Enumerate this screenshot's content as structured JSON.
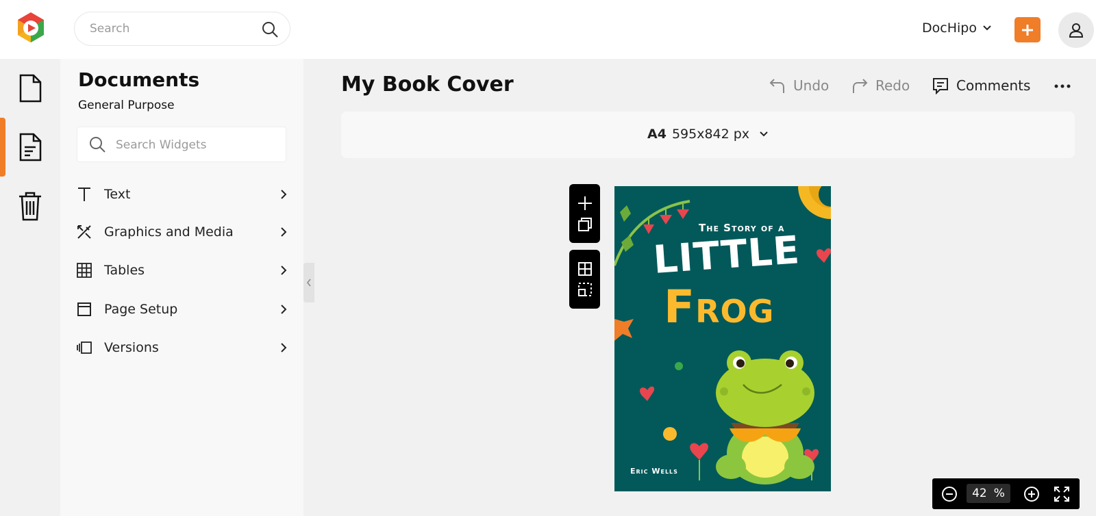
{
  "header": {
    "search_placeholder": "Search",
    "account_name": "DocHipo"
  },
  "panel": {
    "title": "Documents",
    "subtitle": "General Purpose",
    "search_placeholder": "Search Widgets",
    "items": [
      {
        "label": "Text",
        "icon": "text-icon"
      },
      {
        "label": "Graphics and Media",
        "icon": "graphics-icon"
      },
      {
        "label": "Tables",
        "icon": "table-icon"
      },
      {
        "label": "Page Setup",
        "icon": "page-setup-icon"
      },
      {
        "label": "Versions",
        "icon": "versions-icon"
      }
    ]
  },
  "editor": {
    "doc_title": "My Book Cover",
    "undo_label": "Undo",
    "redo_label": "Redo",
    "comments_label": "Comments",
    "page_size_name": "A4",
    "page_size_dims": "595x842 px"
  },
  "cover": {
    "kicker": "The Story of a",
    "line1": "LITTLE",
    "line2": "Frog",
    "author": "Eric Wells"
  },
  "zoom": {
    "value": "42",
    "unit": "%"
  },
  "colors": {
    "accent": "#f07d28",
    "cover_bg": "#03595a",
    "title_yellow": "#fbba2e"
  }
}
